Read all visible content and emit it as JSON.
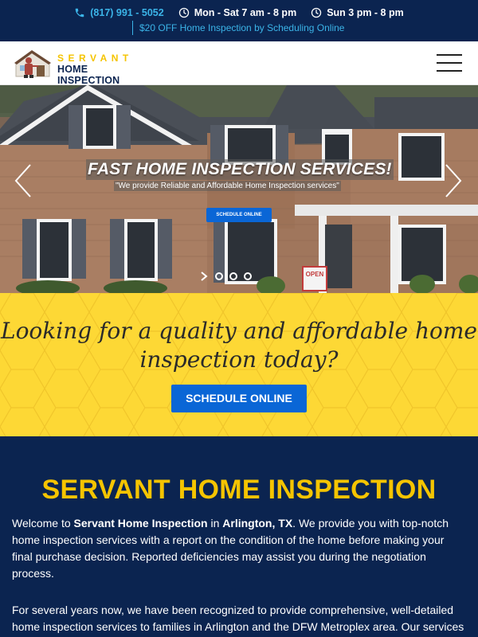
{
  "topbar": {
    "phone": "(817) 991 - 5052",
    "hours_weekday": "Mon - Sat 7 am - 8 pm",
    "hours_sunday": "Sun 3 pm - 8 pm",
    "promo": "$20 OFF Home Inspection by Scheduling Online",
    "accent_color": "#3bb4e8",
    "background_color": "#0b2450"
  },
  "header": {
    "logo_name": "SERVANT",
    "logo_sub": "HOME INSPECTION",
    "menu_icon": "hamburger-icon"
  },
  "hero": {
    "title": "FAST HOME INSPECTION SERVICES!",
    "subtitle": "\"We provide Reliable and Affordable Home Inspection services\"",
    "button_label": "SCHEDULE ONLINE",
    "sign_text": "OPEN",
    "slides": 3,
    "active_slide": 1
  },
  "cta": {
    "line1": "Looking for a quality and affordable home",
    "line2": "inspection today?",
    "button_label": "SCHEDULE ONLINE",
    "background_color": "#fdd835",
    "button_color": "#0a66d6"
  },
  "about": {
    "title": "SERVANT HOME INSPECTION",
    "p1_a": "Welcome to ",
    "p1_b": "Servant Home Inspection",
    "p1_c": " in ",
    "p1_d": "Arlington, TX",
    "p1_e": ". We provide you with top-notch home inspection services with a report on the condition of the home before making your final purchase decision. Reported deficiencies may assist you during the negotiation process.",
    "p2": "For several years now, we have been recognized to provide comprehensive, well-detailed home inspection services to families in Arlington and the DFW Metroplex area. Our services",
    "title_color": "#f5c400"
  }
}
